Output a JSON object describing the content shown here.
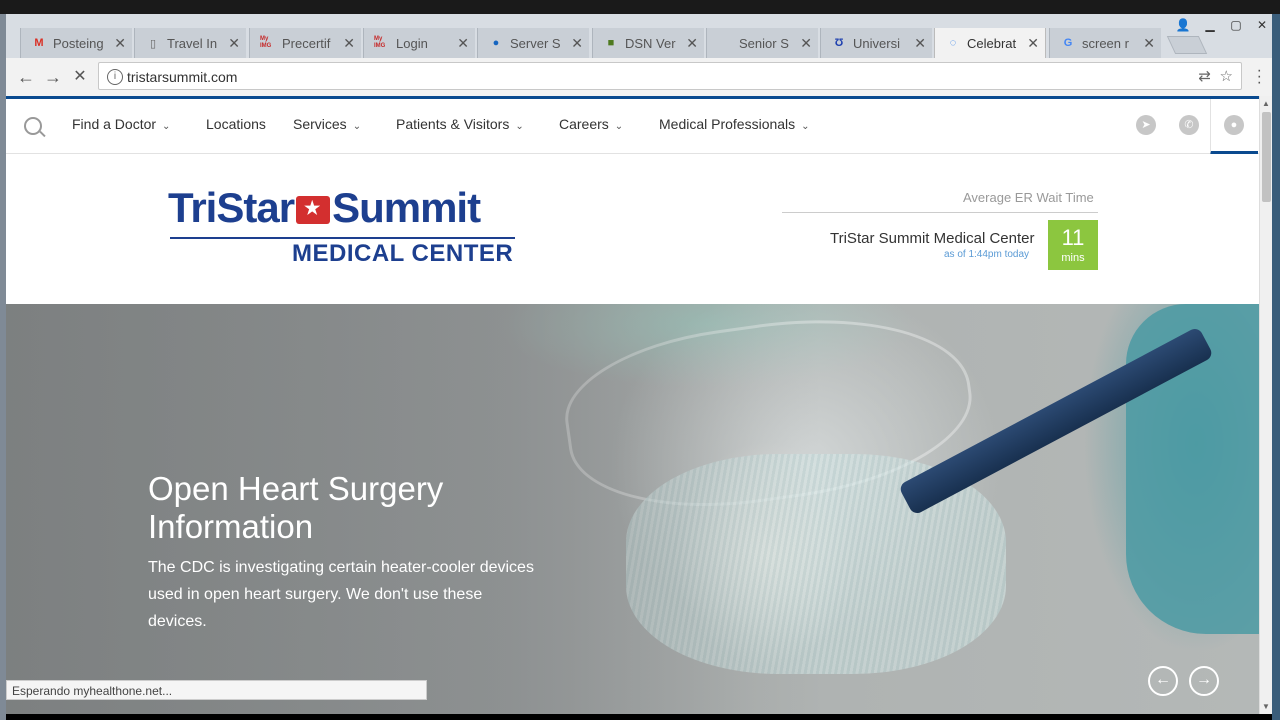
{
  "browser": {
    "tabs": [
      {
        "title": "Posteing",
        "icon": "M",
        "icon_color": "#d93025",
        "icon_name": "gmail-icon"
      },
      {
        "title": "Travel In",
        "icon": "▯",
        "icon_color": "#666666",
        "icon_name": "document-icon"
      },
      {
        "title": "Precertif",
        "icon": "My IMG",
        "icon_color": "#c62828",
        "icon_name": "myimg-icon"
      },
      {
        "title": "Login",
        "icon": "My IMG",
        "icon_color": "#c62828",
        "icon_name": "myimg-icon"
      },
      {
        "title": "Server S",
        "icon": "●",
        "icon_color": "#1565c0",
        "icon_name": "server-icon"
      },
      {
        "title": "DSN Ver",
        "icon": "■",
        "icon_color": "#4e7a1f",
        "icon_name": "dsn-icon"
      },
      {
        "title": "Senior S",
        "icon": "",
        "icon_color": "#666666",
        "icon_name": "blank-icon"
      },
      {
        "title": "Universi",
        "icon": "Ʊ",
        "icon_color": "#1e40af",
        "icon_name": "university-icon"
      },
      {
        "title": "Celebrat",
        "icon": "◌",
        "icon_color": "#1a73e8",
        "icon_name": "loading-spinner-icon"
      },
      {
        "title": "screen r",
        "icon": "G",
        "icon_color": "#4285f4",
        "icon_name": "google-icon"
      }
    ],
    "active_tab_index": 8,
    "url": "tristarsummit.com",
    "status_text": "Esperando myhealthone.net..."
  },
  "nav": {
    "items": [
      {
        "label": "Find a Doctor",
        "dropdown": true
      },
      {
        "label": "Locations",
        "dropdown": false
      },
      {
        "label": "Services",
        "dropdown": true
      },
      {
        "label": "Patients & Visitors",
        "dropdown": true
      },
      {
        "label": "Careers",
        "dropdown": true
      },
      {
        "label": "Medical Professionals",
        "dropdown": true
      }
    ]
  },
  "logo": {
    "line1_a": "TriStar",
    "line1_b": "Summit",
    "line2": "MEDICAL CENTER"
  },
  "er": {
    "title": "Average ER Wait Time",
    "facility": "TriStar Summit Medical Center",
    "as_of": "as of 1:44pm today",
    "minutes": "11",
    "unit": "mins",
    "color": "#8cc63f"
  },
  "hero": {
    "title": "Open Heart Surgery Information",
    "body": "The CDC is investigating certain heater-cooler devices used in open heart surgery. We don't use these devices."
  },
  "colors": {
    "brand_blue": "#1d3f8f",
    "brand_red": "#d32f2f",
    "topline": "#0a4a8f"
  }
}
